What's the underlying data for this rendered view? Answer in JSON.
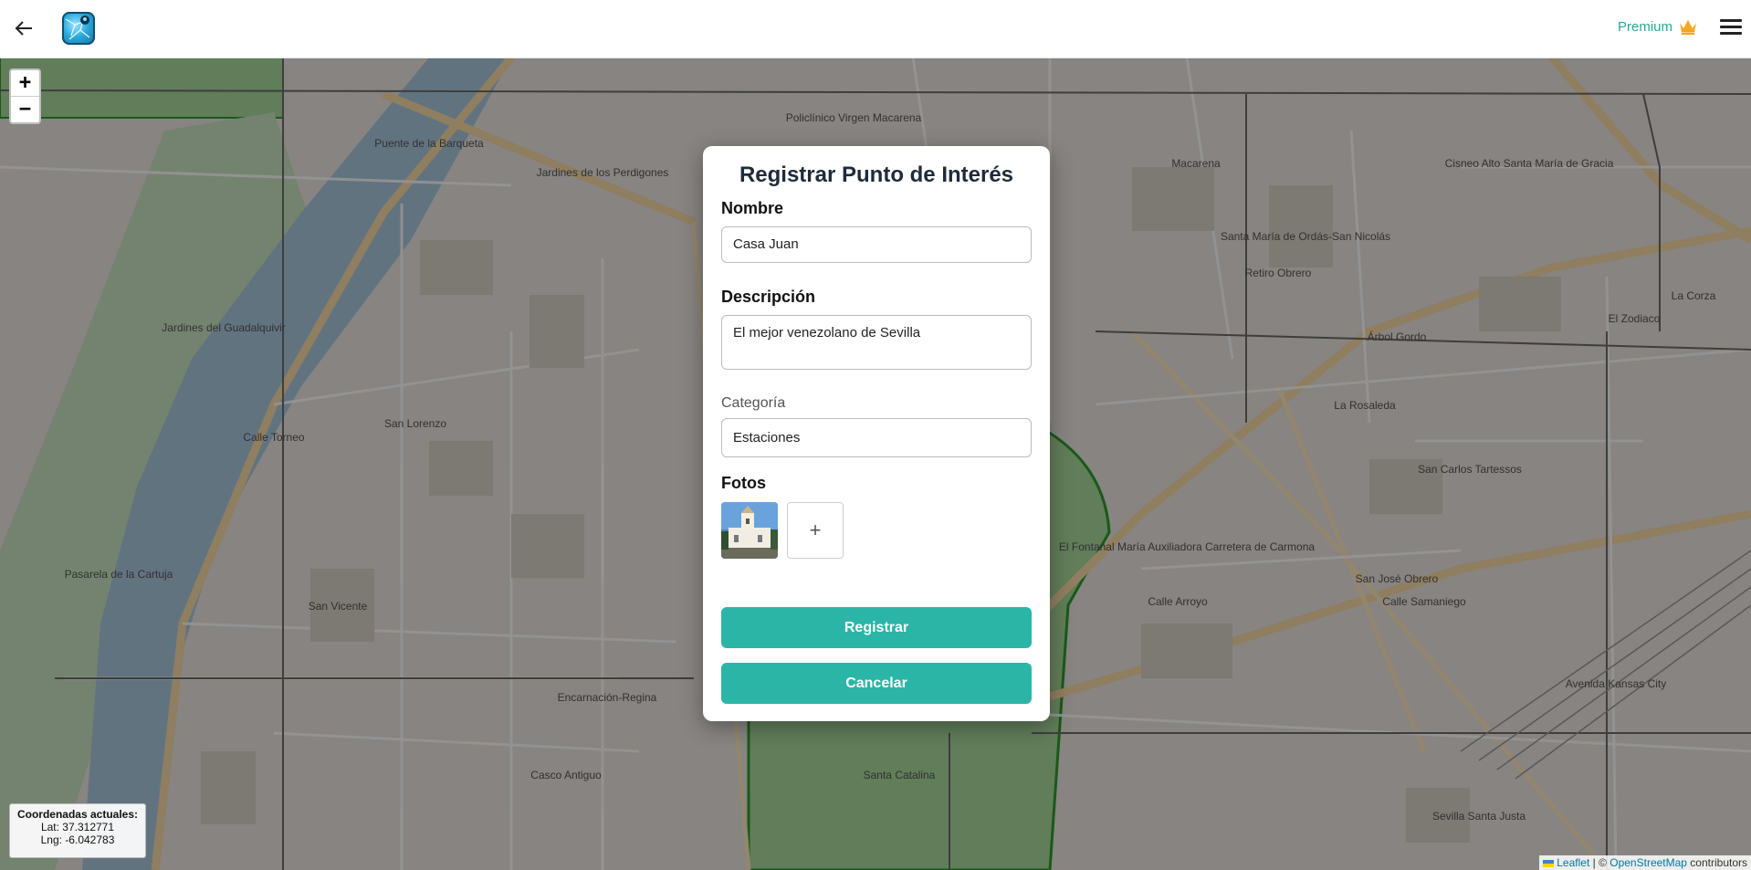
{
  "header": {
    "premium_label": "Premium",
    "icons": {
      "back": "arrow-left-icon",
      "logo": "app-logo-icon",
      "premium": "crown-icon",
      "menu": "hamburger-menu-icon"
    },
    "accent_color": "#23a99a"
  },
  "map": {
    "zoom_in": "+",
    "zoom_out": "−",
    "labels": [
      "Puente de la Barqueta",
      "Jardines del Guadalquivir",
      "Pasarela de la Cartuja",
      "San Lorenzo",
      "San Vicente",
      "Encarnación-Regina",
      "Casco Antiguo",
      "Macarena",
      "Santa María de Ordás-San Nicolás",
      "Retiro Obrero",
      "Árbol Gordo",
      "La Rosaleda",
      "San Carlos Tartessos",
      "El Fontanal María Auxiliadora Carretera de Carmona",
      "San José Obrero",
      "Santa Catalina",
      "Sevilla Santa Justa",
      "Cisneo Alto Santa María de Gracia",
      "El Zodiaco",
      "La Corza",
      "Policlínico Virgen Macarena",
      "Jardines de los Perdigones",
      "Calle Torneo",
      "Avenida Kansas City",
      "Calle Arroyo",
      "Calle Samaniego"
    ],
    "coords": {
      "title": "Coordenadas actuales:",
      "lat": "Lat: 37.312771",
      "lng": "Lng: -6.042783"
    },
    "attribution": {
      "leaflet": "Leaflet",
      "sep": " | © ",
      "osm": "OpenStreetMap",
      "suffix": " contributors"
    }
  },
  "modal": {
    "title": "Registrar Punto de Interés",
    "name_label": "Nombre",
    "name_value": "Casa Juan",
    "description_label": "Descripción",
    "description_value": "El mejor venezolano de Sevilla",
    "category_label": "Categoría",
    "category_value": "Estaciones",
    "photos_label": "Fotos",
    "add_photo": "+",
    "register_button": "Registrar",
    "cancel_button": "Cancelar",
    "button_color": "#2bb5a6"
  }
}
